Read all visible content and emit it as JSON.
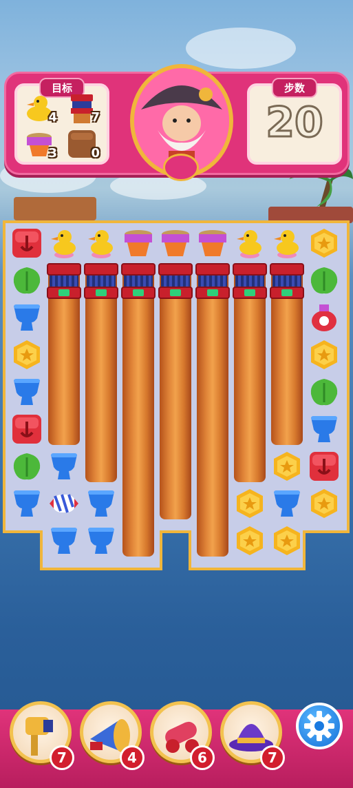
{
  "hud": {
    "goal_title": "目标",
    "moves_title": "步数",
    "moves_left": "20",
    "goals": [
      {
        "icon": "rubber-duck-icon",
        "count": "4"
      },
      {
        "icon": "pillar-icon",
        "count": "7"
      },
      {
        "icon": "purple-bucket-icon",
        "count": "3"
      },
      {
        "icon": "dirt-block-icon",
        "count": "0"
      }
    ]
  },
  "boosters": [
    {
      "icon": "hammer-booster-icon",
      "count": "7"
    },
    {
      "icon": "horn-booster-icon",
      "count": "4"
    },
    {
      "icon": "cannon-booster-icon",
      "count": "6"
    },
    {
      "icon": "wizard-hat-booster-icon",
      "count": "7"
    }
  ],
  "settings_icon": "gear-icon",
  "colors": {
    "hud_pink": "#e0337a",
    "gold_border": "#f0b63b",
    "board_bg": "#c7cde8"
  }
}
